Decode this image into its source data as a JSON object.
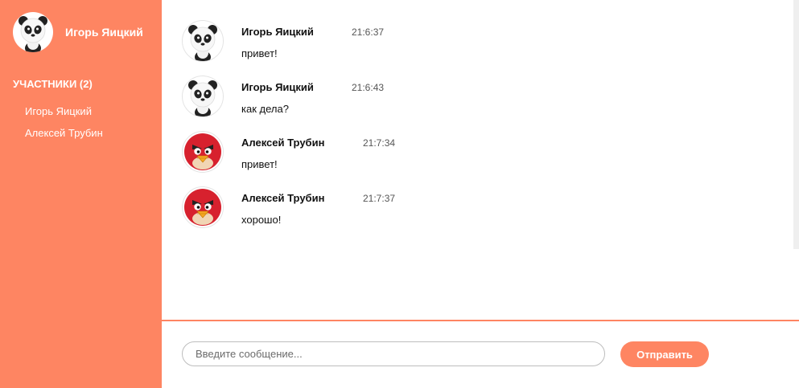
{
  "sidebar": {
    "current_user": {
      "name": "Игорь Яицкий",
      "avatar_icon": "panda-avatar-icon"
    },
    "participants_title": "УЧАСТНИКИ (2)",
    "participants": [
      {
        "name": "Игорь Яицкий"
      },
      {
        "name": "Алексей Трубин"
      }
    ]
  },
  "messages": [
    {
      "author": "Игорь Яицкий",
      "time": "21:6:37",
      "text": "привет!",
      "avatar_icon": "panda-avatar-icon"
    },
    {
      "author": "Игорь Яицкий",
      "time": "21:6:43",
      "text": "как дела?",
      "avatar_icon": "panda-avatar-icon"
    },
    {
      "author": "Алексей Трубин",
      "time": "21:7:34",
      "text": "привет!",
      "avatar_icon": "angry-bird-avatar-icon"
    },
    {
      "author": "Алексей Трубин",
      "time": "21:7:37",
      "text": "хорошо!",
      "avatar_icon": "angry-bird-avatar-icon"
    }
  ],
  "composer": {
    "placeholder": "Введите сообщение...",
    "value": "",
    "send_label": "Отправить"
  },
  "colors": {
    "accent": "#fe8562",
    "bird_red": "#d7212e",
    "text": "#111111"
  }
}
